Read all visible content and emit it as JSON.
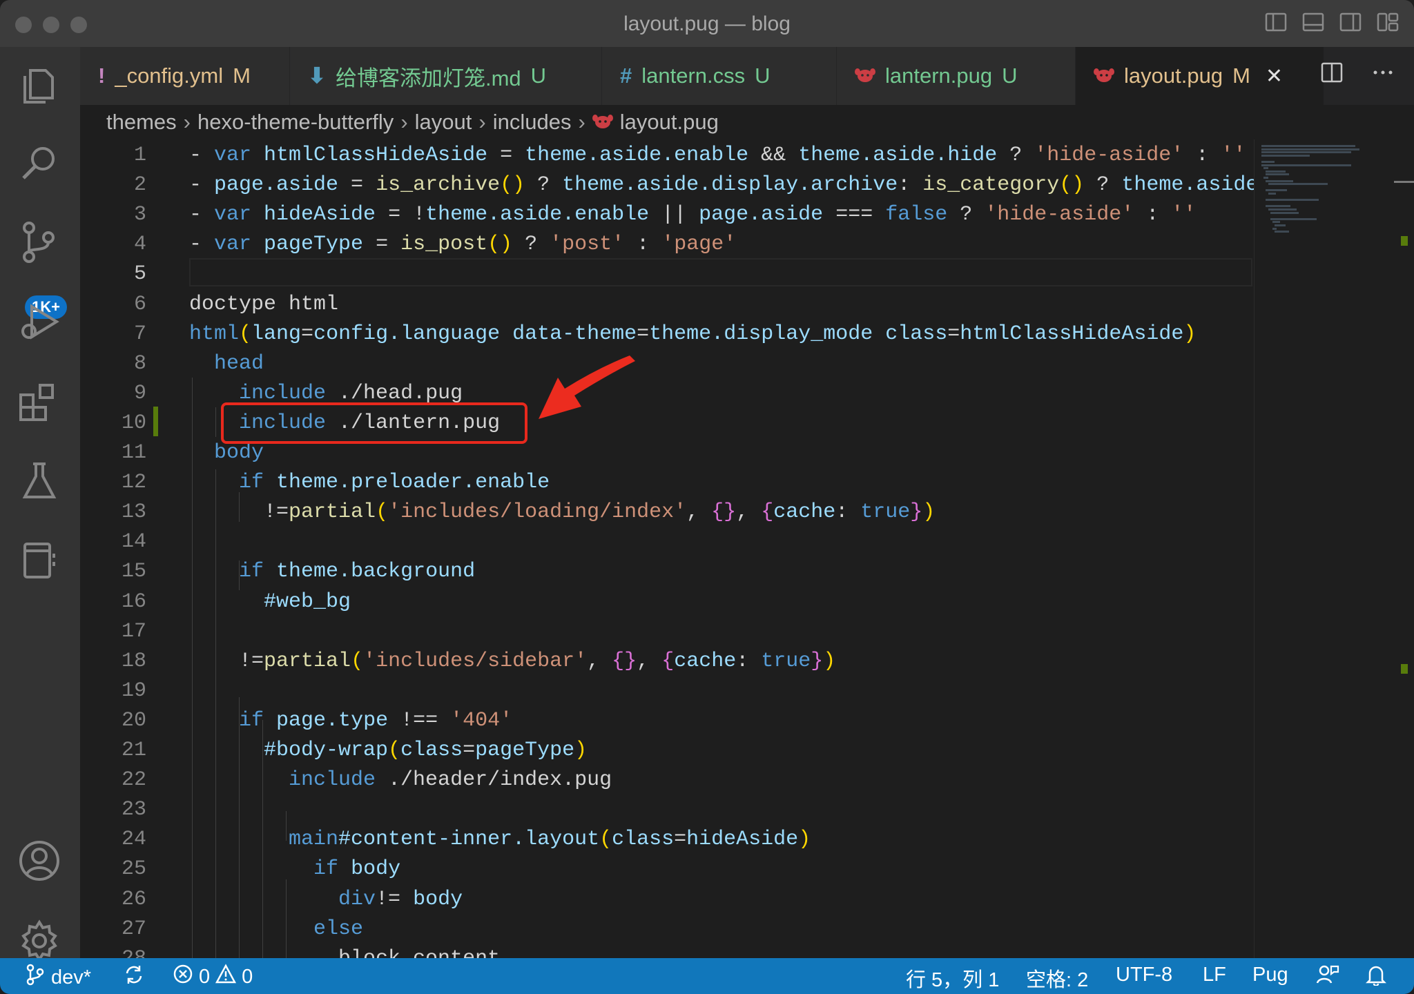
{
  "window": {
    "title": "layout.pug — blog"
  },
  "activity": {
    "badge": "1K+"
  },
  "tabs": [
    {
      "icon": "!",
      "label": "_config.yml",
      "status": "M",
      "label_color": "#e2c08d",
      "icon_color": "#c586c0",
      "status_color": "#e2c08d"
    },
    {
      "icon": "⬇",
      "label": "给博客添加灯笼.md",
      "status": "U",
      "label_color": "#73c991",
      "icon_color": "#519aba",
      "status_color": "#73c991"
    },
    {
      "icon": "#",
      "label": "lantern.css",
      "status": "U",
      "label_color": "#73c991",
      "icon_color": "#519aba",
      "status_color": "#73c991"
    },
    {
      "icon": "🐶",
      "label": "lantern.pug",
      "status": "U",
      "label_color": "#73c991",
      "icon_color": "#cc3e44",
      "status_color": "#73c991"
    },
    {
      "icon": "🐶",
      "label": "layout.pug",
      "status": "M",
      "label_color": "#e2c08d",
      "icon_color": "#cc3e44",
      "status_color": "#e2c08d",
      "active": true,
      "close": "✕"
    }
  ],
  "breadcrumb": [
    "themes",
    "hexo-theme-butterfly",
    "layout",
    "includes",
    "layout.pug"
  ],
  "code_lines": [
    {
      "n": "1"
    },
    {
      "n": "2"
    },
    {
      "n": "3"
    },
    {
      "n": "4"
    },
    {
      "n": "5"
    },
    {
      "n": "6"
    },
    {
      "n": "7"
    },
    {
      "n": "8"
    },
    {
      "n": "9"
    },
    {
      "n": "10"
    },
    {
      "n": "11"
    },
    {
      "n": "12"
    },
    {
      "n": "13"
    },
    {
      "n": "14"
    },
    {
      "n": "15"
    },
    {
      "n": "16"
    },
    {
      "n": "17"
    },
    {
      "n": "18"
    },
    {
      "n": "19"
    },
    {
      "n": "20"
    },
    {
      "n": "21"
    },
    {
      "n": "22"
    },
    {
      "n": "23"
    },
    {
      "n": "24"
    },
    {
      "n": "25"
    },
    {
      "n": "26"
    },
    {
      "n": "27"
    },
    {
      "n": "28"
    }
  ],
  "code": {
    "l1": [
      [
        "p",
        "- "
      ],
      [
        "k",
        "var "
      ],
      [
        "v",
        "htmlClassHideAside"
      ],
      [
        "p",
        " = "
      ],
      [
        "v",
        "theme.aside.enable"
      ],
      [
        "p",
        " && "
      ],
      [
        "v",
        "theme.aside.hide"
      ],
      [
        "p",
        " ? "
      ],
      [
        "s",
        "'hide-aside'"
      ],
      [
        "p",
        " : "
      ],
      [
        "s",
        "''"
      ]
    ],
    "l2": [
      [
        "p",
        "- "
      ],
      [
        "v",
        "page.aside"
      ],
      [
        "p",
        " = "
      ],
      [
        "f",
        "is_archive"
      ],
      [
        "b1",
        "()"
      ],
      [
        "p",
        " ? "
      ],
      [
        "v",
        "theme.aside.display.archive"
      ],
      [
        "p",
        ": "
      ],
      [
        "f",
        "is_category"
      ],
      [
        "b1",
        "()"
      ],
      [
        "p",
        " ? "
      ],
      [
        "v",
        "theme.aside.di"
      ]
    ],
    "l3": [
      [
        "p",
        "- "
      ],
      [
        "k",
        "var "
      ],
      [
        "v",
        "hideAside"
      ],
      [
        "p",
        " = !"
      ],
      [
        "v",
        "theme.aside.enable"
      ],
      [
        "p",
        " || "
      ],
      [
        "v",
        "page.aside"
      ],
      [
        "p",
        " === "
      ],
      [
        "k",
        "false"
      ],
      [
        "p",
        " ? "
      ],
      [
        "s",
        "'hide-aside'"
      ],
      [
        "p",
        " : "
      ],
      [
        "s",
        "''"
      ]
    ],
    "l4": [
      [
        "p",
        "- "
      ],
      [
        "k",
        "var "
      ],
      [
        "v",
        "pageType"
      ],
      [
        "p",
        " = "
      ],
      [
        "f",
        "is_post"
      ],
      [
        "b1",
        "()"
      ],
      [
        "p",
        " ? "
      ],
      [
        "s",
        "'post'"
      ],
      [
        "p",
        " : "
      ],
      [
        "s",
        "'page'"
      ]
    ],
    "l5": [],
    "l6": [
      [
        "p",
        "doctype html"
      ]
    ],
    "l7": [
      [
        "k",
        "html"
      ],
      [
        "b1",
        "("
      ],
      [
        "v",
        "lang"
      ],
      [
        "p",
        "="
      ],
      [
        "v",
        "config.language"
      ],
      [
        "p",
        " "
      ],
      [
        "v",
        "data-theme"
      ],
      [
        "p",
        "="
      ],
      [
        "v",
        "theme.display_mode"
      ],
      [
        "p",
        " "
      ],
      [
        "v",
        "class"
      ],
      [
        "p",
        "="
      ],
      [
        "v",
        "htmlClassHideAside"
      ],
      [
        "b1",
        ")"
      ]
    ],
    "l8": [
      [
        "k",
        "  head"
      ]
    ],
    "l9": [
      [
        "k",
        "    include"
      ],
      [
        "p",
        " ./head.pug"
      ]
    ],
    "l10": [
      [
        "k",
        "    include"
      ],
      [
        "p",
        " ./lantern.pug"
      ]
    ],
    "l11": [
      [
        "k",
        "  body"
      ]
    ],
    "l12": [
      [
        "k",
        "    if"
      ],
      [
        "p",
        " "
      ],
      [
        "v",
        "theme.preloader.enable"
      ]
    ],
    "l13": [
      [
        "p",
        "      !="
      ],
      [
        "f",
        "partial"
      ],
      [
        "b1",
        "("
      ],
      [
        "s",
        "'includes/loading/index'"
      ],
      [
        "p",
        ", "
      ],
      [
        "b2",
        "{}"
      ],
      [
        "p",
        ", "
      ],
      [
        "b2",
        "{"
      ],
      [
        "v",
        "cache"
      ],
      [
        "p",
        ": "
      ],
      [
        "k",
        "true"
      ],
      [
        "b2",
        "}"
      ],
      [
        "b1",
        ")"
      ]
    ],
    "l14": [],
    "l15": [
      [
        "k",
        "    if"
      ],
      [
        "p",
        " "
      ],
      [
        "v",
        "theme.background"
      ]
    ],
    "l16": [
      [
        "v",
        "      #web_bg"
      ]
    ],
    "l17": [],
    "l18": [
      [
        "p",
        "    !="
      ],
      [
        "f",
        "partial"
      ],
      [
        "b1",
        "("
      ],
      [
        "s",
        "'includes/sidebar'"
      ],
      [
        "p",
        ", "
      ],
      [
        "b2",
        "{}"
      ],
      [
        "p",
        ", "
      ],
      [
        "b2",
        "{"
      ],
      [
        "v",
        "cache"
      ],
      [
        "p",
        ": "
      ],
      [
        "k",
        "true"
      ],
      [
        "b2",
        "}"
      ],
      [
        "b1",
        ")"
      ]
    ],
    "l19": [],
    "l20": [
      [
        "k",
        "    if"
      ],
      [
        "p",
        " "
      ],
      [
        "v",
        "page.type"
      ],
      [
        "p",
        " !== "
      ],
      [
        "s",
        "'404'"
      ]
    ],
    "l21": [
      [
        "v",
        "      #body-wrap"
      ],
      [
        "b1",
        "("
      ],
      [
        "v",
        "class"
      ],
      [
        "p",
        "="
      ],
      [
        "v",
        "pageType"
      ],
      [
        "b1",
        ")"
      ]
    ],
    "l22": [
      [
        "k",
        "        include"
      ],
      [
        "p",
        " ./header/index.pug"
      ]
    ],
    "l23": [],
    "l24": [
      [
        "k",
        "        main"
      ],
      [
        "v",
        "#content-inner.layout"
      ],
      [
        "b1",
        "("
      ],
      [
        "v",
        "class"
      ],
      [
        "p",
        "="
      ],
      [
        "v",
        "hideAside"
      ],
      [
        "b1",
        ")"
      ]
    ],
    "l25": [
      [
        "k",
        "          if"
      ],
      [
        "p",
        " "
      ],
      [
        "v",
        "body"
      ]
    ],
    "l26": [
      [
        "k",
        "            div"
      ],
      [
        "p",
        "!= "
      ],
      [
        "v",
        "body"
      ]
    ],
    "l27": [
      [
        "k",
        "          else"
      ]
    ],
    "l28": [
      [
        "p",
        "            block content"
      ]
    ]
  },
  "status": {
    "branch": "dev*",
    "errors": "0",
    "warnings": "0",
    "position": "行 5，列 1",
    "spaces": "空格: 2",
    "encoding": "UTF-8",
    "eol": "LF",
    "language": "Pug"
  },
  "colors": {
    "statusbar": "#1177bb",
    "highlight": "#e8291d",
    "activity_badge": "#0e72c7"
  }
}
